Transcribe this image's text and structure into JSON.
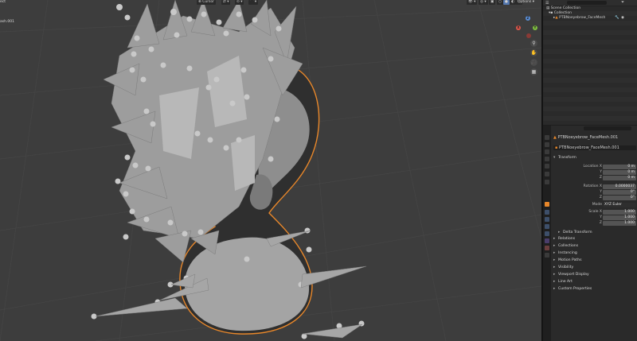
{
  "viewport": {
    "header_left": "ect",
    "header_obj": "ash.001",
    "cursor_label": "Cursor",
    "options_label": "Options",
    "gizmo": {
      "x": "X",
      "y": "Y",
      "z": "Z"
    }
  },
  "outliner": {
    "rows": [
      {
        "label": "Scene Collection"
      },
      {
        "label": "Collection"
      },
      {
        "label": "PTBNoeyebrow_FaceMesh"
      }
    ]
  },
  "properties": {
    "header_object": "PTBNoeyebrow_FaceMesh.001",
    "object_name": "PTBNoeyebrow_FaceMesh.001",
    "transform_label": "Transform",
    "location_label": "Location X",
    "location": {
      "x": "0 m",
      "y": "0 m",
      "z": "0 m"
    },
    "rotation_label": "Rotation X",
    "rotation": {
      "x": "0.0000037",
      "y": "0°",
      "z": "0°"
    },
    "mode_label": "Mode",
    "mode_value": "XYZ Euler",
    "scale_label": "Scale X",
    "scale": {
      "x": "1.000",
      "y": "1.000",
      "z": "1.000"
    },
    "axis_y": "Y",
    "axis_z": "Z",
    "sections": [
      "Delta Transform",
      "Relations",
      "Collections",
      "Instancing",
      "Motion Paths",
      "Visibility",
      "Viewport Display",
      "Line Art",
      "Custom Properties"
    ]
  },
  "colors": {
    "viewport_bg": "#3d3d3d",
    "selection_outline": "#e8872a",
    "mesh": "#a5a5a5"
  }
}
